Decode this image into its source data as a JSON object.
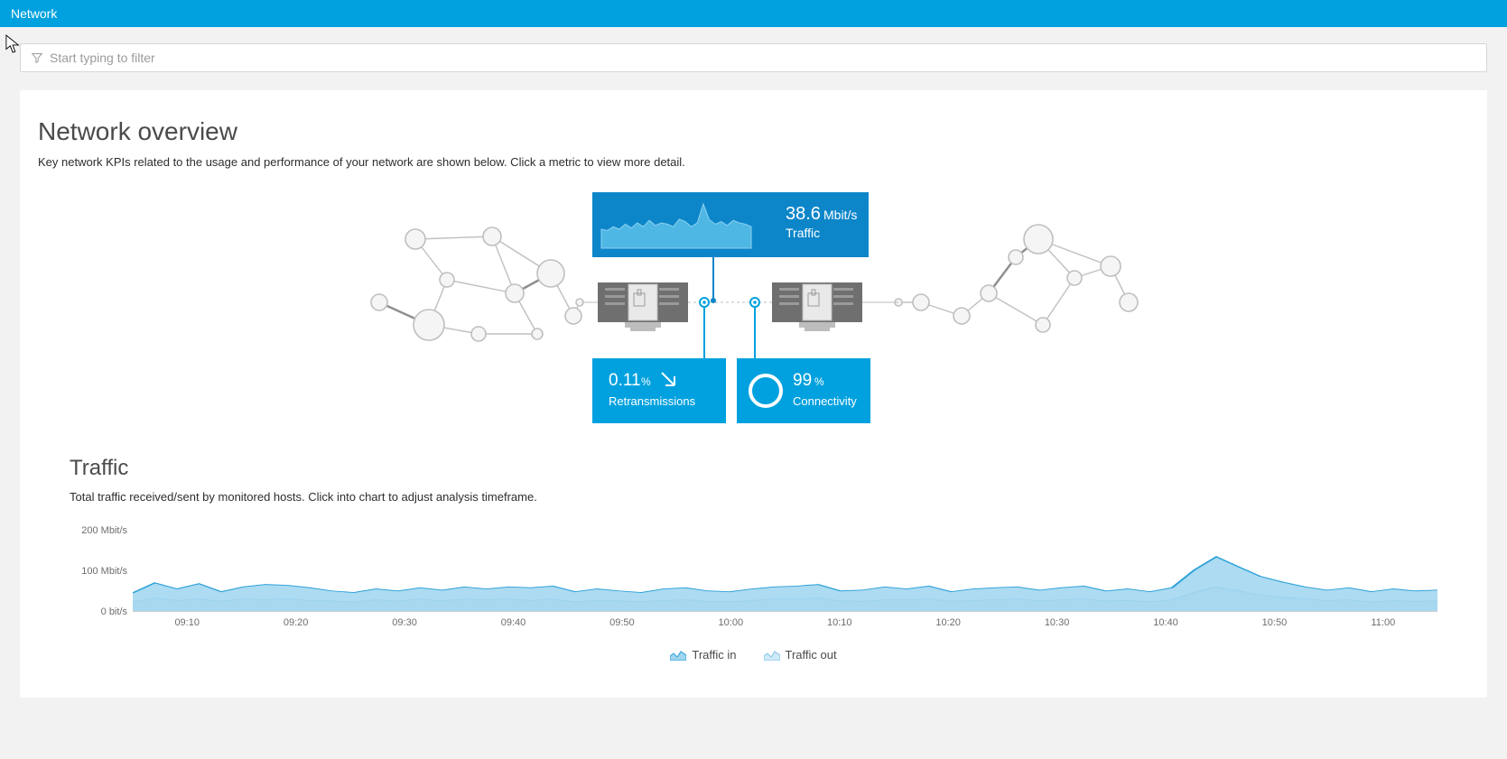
{
  "header": {
    "title": "Network"
  },
  "filter": {
    "placeholder": "Start typing to filter"
  },
  "overview": {
    "title": "Network overview",
    "subtitle": "Key network KPIs related to the usage and performance of your network are shown below. Click a metric to view more detail."
  },
  "kpi": {
    "traffic": {
      "value": "38.6",
      "unit": "Mbit/s",
      "label": "Traffic"
    },
    "retransmissions": {
      "value": "0.11",
      "unit": "%",
      "label": "Retransmissions",
      "trend": "down-right"
    },
    "connectivity": {
      "value": "99",
      "unit": "%",
      "label": "Connectivity"
    }
  },
  "traffic_section": {
    "title": "Traffic",
    "subtitle": "Total traffic received/sent by monitored hosts. Click into chart to adjust analysis timeframe."
  },
  "legend": {
    "in": "Traffic in",
    "out": "Traffic out"
  },
  "chart_data": {
    "type": "area",
    "xlabel": "",
    "ylabel": "",
    "ylim": [
      0,
      200
    ],
    "y_unit": "Mbit/s",
    "y_ticks": [
      "200 Mbit/s",
      "100 Mbit/s",
      "0 bit/s"
    ],
    "x_ticks": [
      "09:10",
      "09:20",
      "09:30",
      "09:40",
      "09:50",
      "10:00",
      "10:10",
      "10:20",
      "10:30",
      "10:40",
      "10:50",
      "11:00"
    ],
    "series": [
      {
        "name": "Traffic in",
        "color_stroke": "#2aa0d8",
        "color_fill": "#9fd5ef",
        "values": [
          45,
          70,
          55,
          68,
          48,
          60,
          66,
          64,
          58,
          50,
          46,
          55,
          50,
          58,
          52,
          60,
          55,
          60,
          58,
          62,
          48,
          55,
          50,
          46,
          55,
          58,
          50,
          48,
          55,
          60,
          62,
          66,
          50,
          52,
          60,
          55,
          62,
          48,
          55,
          58,
          60,
          52,
          58,
          62,
          50,
          55,
          48,
          58,
          102,
          135,
          110,
          86,
          72,
          60,
          52,
          58,
          48,
          55,
          50,
          52
        ]
      },
      {
        "name": "Traffic out",
        "color_stroke": "#7dc3e8",
        "color_fill": "#cfe9f6",
        "values": [
          22,
          32,
          26,
          30,
          24,
          30,
          28,
          31,
          26,
          25,
          22,
          28,
          24,
          30,
          25,
          30,
          28,
          30,
          26,
          30,
          22,
          26,
          25,
          23,
          26,
          28,
          24,
          23,
          26,
          30,
          30,
          32,
          25,
          24,
          28,
          28,
          30,
          24,
          26,
          28,
          30,
          25,
          28,
          30,
          25,
          26,
          23,
          28,
          46,
          60,
          50,
          40,
          34,
          30,
          26,
          28,
          22,
          26,
          24,
          25
        ]
      }
    ]
  },
  "colors": {
    "accent": "#00a1de",
    "accent_dark": "#0d86c9"
  }
}
